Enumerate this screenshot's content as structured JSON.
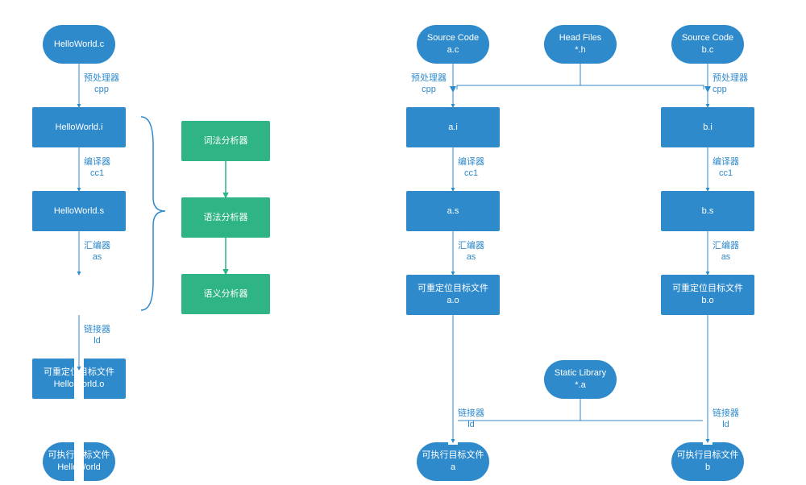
{
  "left": {
    "n1": "HelloWorld.c",
    "n2": "HelloWorld.i",
    "n3": "HelloWorld.s",
    "n4a": "可重定位目标文件",
    "n4b": "HelloWorld.o",
    "n5a": "可执行目标文件",
    "n5b": "HelloWorld",
    "e1a": "预处理器",
    "e1b": "cpp",
    "e2a": "编译器",
    "e2b": "cc1",
    "e3a": "汇编器",
    "e3b": "as",
    "e4a": "链接器",
    "e4b": "ld"
  },
  "analyzers": {
    "g1": "词法分析器",
    "g2": "语法分析器",
    "g3": "语义分析器"
  },
  "right": {
    "src_a_1": "Source Code",
    "src_a_2": "a.c",
    "head_1": "Head Files",
    "head_2": "*.h",
    "src_b_1": "Source Code",
    "src_b_2": "b.c",
    "ai": "a.i",
    "bi": "b.i",
    "as_1": "a.s",
    "bs": "b.s",
    "ao_1": "可重定位目标文件",
    "ao_2": "a.o",
    "bo_1": "可重定位目标文件",
    "bo_2": "b.o",
    "lib_1": "Static Library",
    "lib_2": "*.a",
    "exe_a_1": "可执行目标文件",
    "exe_a_2": "a",
    "exe_b_1": "可执行目标文件",
    "exe_b_2": "b",
    "ea1": "预处理器",
    "ea2": "cpp",
    "eb1": "编译器",
    "eb2": "cc1",
    "ec1": "汇编器",
    "ec2": "as",
    "ed1": "链接器",
    "ed2": "ld"
  }
}
